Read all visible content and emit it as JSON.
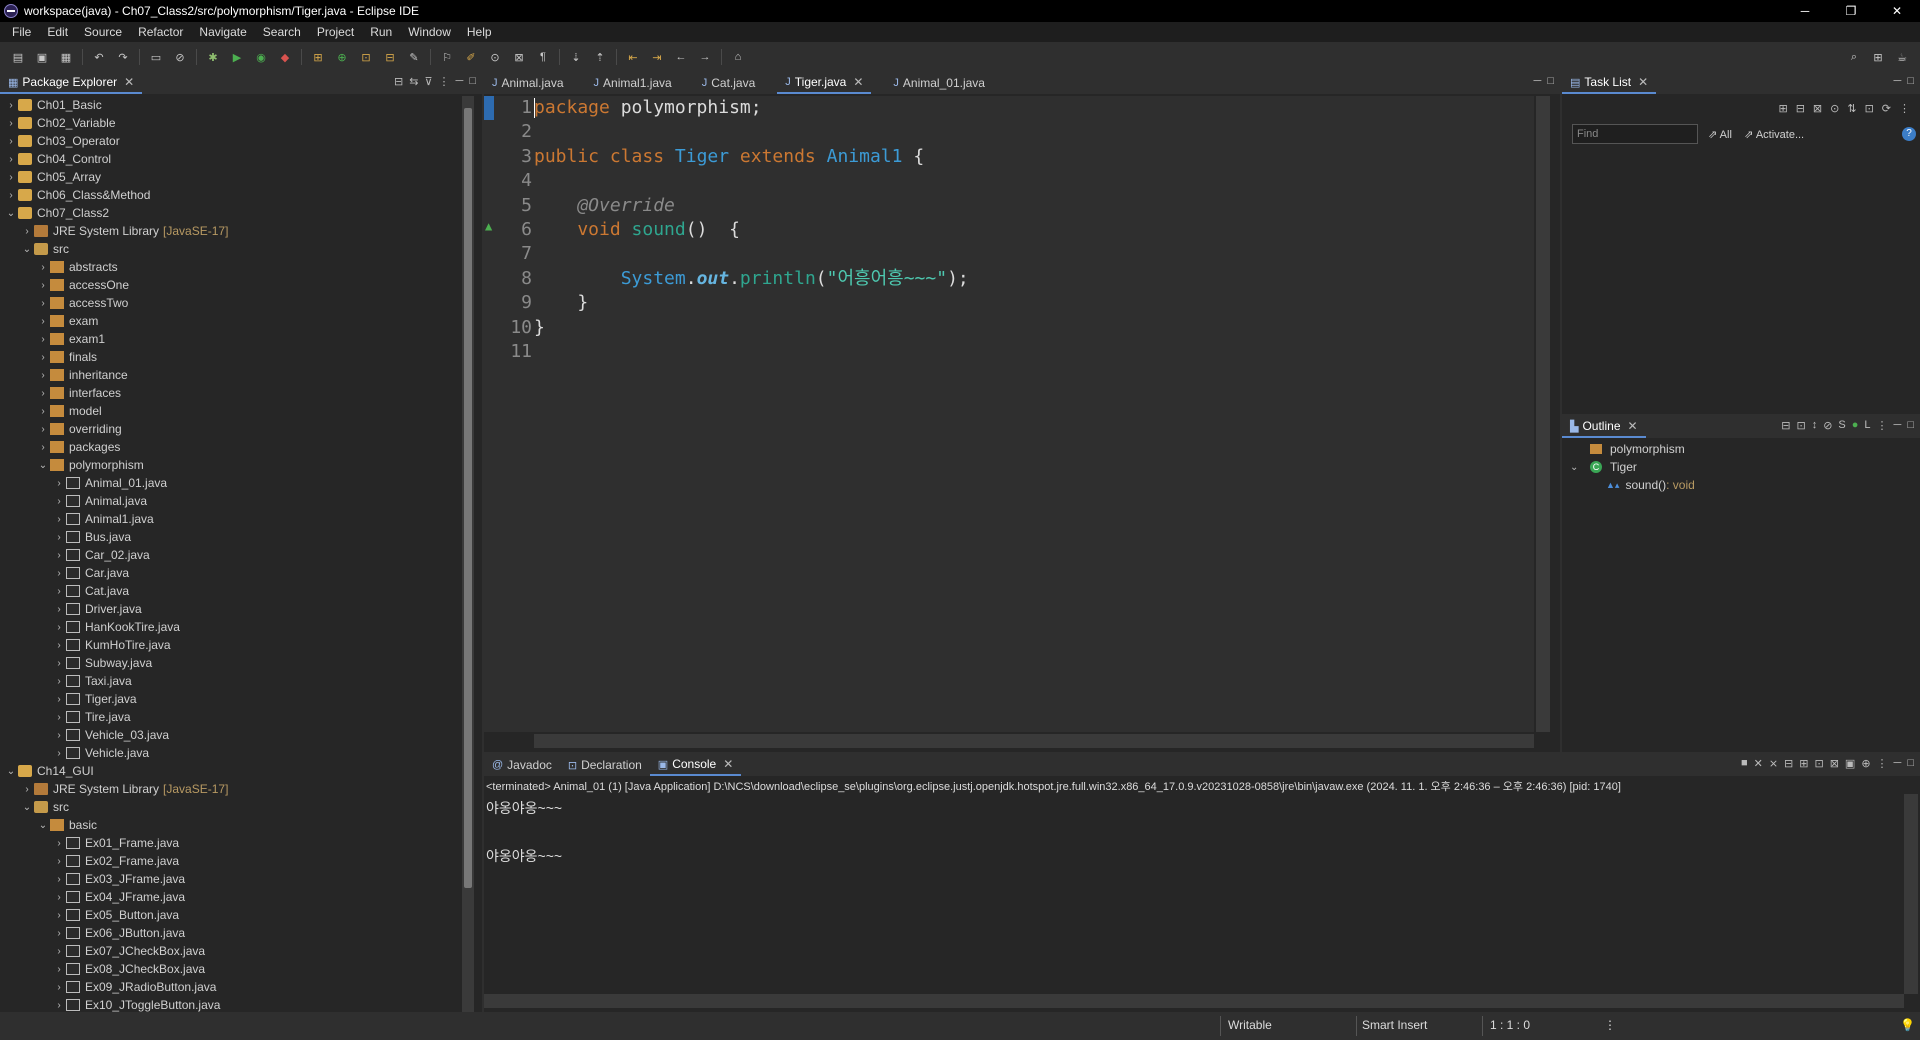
{
  "window": {
    "title": "workspace(java) - Ch07_Class2/src/polymorphism/Tiger.java - Eclipse IDE",
    "controls": [
      "─",
      "❐",
      "✕"
    ]
  },
  "menu": [
    "File",
    "Edit",
    "Source",
    "Refactor",
    "Navigate",
    "Search",
    "Project",
    "Run",
    "Window",
    "Help"
  ],
  "package_explorer": {
    "title": "Package Explorer",
    "items": [
      {
        "label": "Ch01_Basic",
        "level": 0,
        "open": false,
        "type": "project"
      },
      {
        "label": "Ch02_Variable",
        "level": 0,
        "open": false,
        "type": "project"
      },
      {
        "label": "Ch03_Operator",
        "level": 0,
        "open": false,
        "type": "project"
      },
      {
        "label": "Ch04_Control",
        "level": 0,
        "open": false,
        "type": "project"
      },
      {
        "label": "Ch05_Array",
        "level": 0,
        "open": false,
        "type": "project"
      },
      {
        "label": "Ch06_Class&Method",
        "level": 0,
        "open": false,
        "type": "project"
      },
      {
        "label": "Ch07_Class2",
        "level": 0,
        "open": true,
        "type": "project"
      },
      {
        "label": "JRE System Library",
        "suffix": "[JavaSE-17]",
        "level": 1,
        "open": false,
        "type": "lib"
      },
      {
        "label": "src",
        "level": 1,
        "open": true,
        "type": "src"
      },
      {
        "label": "abstracts",
        "level": 2,
        "open": false,
        "type": "pkg"
      },
      {
        "label": "accessOne",
        "level": 2,
        "open": false,
        "type": "pkg"
      },
      {
        "label": "accessTwo",
        "level": 2,
        "open": false,
        "type": "pkg"
      },
      {
        "label": "exam",
        "level": 2,
        "open": false,
        "type": "pkg"
      },
      {
        "label": "exam1",
        "level": 2,
        "open": false,
        "type": "pkg"
      },
      {
        "label": "finals",
        "level": 2,
        "open": false,
        "type": "pkg"
      },
      {
        "label": "inheritance",
        "level": 2,
        "open": false,
        "type": "pkg"
      },
      {
        "label": "interfaces",
        "level": 2,
        "open": false,
        "type": "pkg"
      },
      {
        "label": "model",
        "level": 2,
        "open": false,
        "type": "pkg"
      },
      {
        "label": "overriding",
        "level": 2,
        "open": false,
        "type": "pkg"
      },
      {
        "label": "packages",
        "level": 2,
        "open": false,
        "type": "pkg"
      },
      {
        "label": "polymorphism",
        "level": 2,
        "open": true,
        "type": "pkg"
      },
      {
        "label": "Animal_01.java",
        "level": 3,
        "open": false,
        "type": "java"
      },
      {
        "label": "Animal.java",
        "level": 3,
        "open": false,
        "type": "java"
      },
      {
        "label": "Animal1.java",
        "level": 3,
        "open": false,
        "type": "java"
      },
      {
        "label": "Bus.java",
        "level": 3,
        "open": false,
        "type": "java"
      },
      {
        "label": "Car_02.java",
        "level": 3,
        "open": false,
        "type": "java"
      },
      {
        "label": "Car.java",
        "level": 3,
        "open": false,
        "type": "java"
      },
      {
        "label": "Cat.java",
        "level": 3,
        "open": false,
        "type": "java"
      },
      {
        "label": "Driver.java",
        "level": 3,
        "open": false,
        "type": "java"
      },
      {
        "label": "HanKookTire.java",
        "level": 3,
        "open": false,
        "type": "java"
      },
      {
        "label": "KumHoTire.java",
        "level": 3,
        "open": false,
        "type": "java"
      },
      {
        "label": "Subway.java",
        "level": 3,
        "open": false,
        "type": "java"
      },
      {
        "label": "Taxi.java",
        "level": 3,
        "open": false,
        "type": "java"
      },
      {
        "label": "Tiger.java",
        "level": 3,
        "open": false,
        "type": "java"
      },
      {
        "label": "Tire.java",
        "level": 3,
        "open": false,
        "type": "java"
      },
      {
        "label": "Vehicle_03.java",
        "level": 3,
        "open": false,
        "type": "java"
      },
      {
        "label": "Vehicle.java",
        "level": 3,
        "open": false,
        "type": "java"
      },
      {
        "label": "Ch14_GUI",
        "level": 0,
        "open": true,
        "type": "project"
      },
      {
        "label": "JRE System Library",
        "suffix": "[JavaSE-17]",
        "level": 1,
        "open": false,
        "type": "lib"
      },
      {
        "label": "src",
        "level": 1,
        "open": true,
        "type": "src"
      },
      {
        "label": "basic",
        "level": 2,
        "open": true,
        "type": "pkg"
      },
      {
        "label": "Ex01_Frame.java",
        "level": 3,
        "open": false,
        "type": "java"
      },
      {
        "label": "Ex02_Frame.java",
        "level": 3,
        "open": false,
        "type": "java"
      },
      {
        "label": "Ex03_JFrame.java",
        "level": 3,
        "open": false,
        "type": "java"
      },
      {
        "label": "Ex04_JFrame.java",
        "level": 3,
        "open": false,
        "type": "java"
      },
      {
        "label": "Ex05_Button.java",
        "level": 3,
        "open": false,
        "type": "java"
      },
      {
        "label": "Ex06_JButton.java",
        "level": 3,
        "open": false,
        "type": "java"
      },
      {
        "label": "Ex07_JCheckBox.java",
        "level": 3,
        "open": false,
        "type": "java"
      },
      {
        "label": "Ex08_JCheckBox.java",
        "level": 3,
        "open": false,
        "type": "java"
      },
      {
        "label": "Ex09_JRadioButton.java",
        "level": 3,
        "open": false,
        "type": "java"
      },
      {
        "label": "Ex10_JToggleButton.java",
        "level": 3,
        "open": false,
        "type": "java"
      }
    ]
  },
  "editor": {
    "tabs": [
      {
        "label": "Animal.java",
        "active": false
      },
      {
        "label": "Animal1.java",
        "active": false
      },
      {
        "label": "Cat.java",
        "active": false
      },
      {
        "label": "Tiger.java",
        "active": true
      },
      {
        "label": "Animal_01.java",
        "active": false
      }
    ],
    "lines": [
      {
        "n": "1",
        "parts": [
          {
            "t": "package",
            "c": "kw"
          },
          {
            "t": " polymorphism;",
            "c": "plain"
          }
        ]
      },
      {
        "n": "2",
        "parts": []
      },
      {
        "n": "3",
        "parts": [
          {
            "t": "public class ",
            "c": "kw"
          },
          {
            "t": "Tiger",
            "c": "cls"
          },
          {
            "t": " extends ",
            "c": "kw"
          },
          {
            "t": "Animal1",
            "c": "cls"
          },
          {
            "t": " {",
            "c": "plain"
          }
        ]
      },
      {
        "n": "4",
        "parts": []
      },
      {
        "n": "5",
        "parts": [
          {
            "t": "    @Override",
            "c": "ann"
          }
        ]
      },
      {
        "n": "6",
        "parts": [
          {
            "t": "    void ",
            "c": "kw"
          },
          {
            "t": "sound",
            "c": "mth"
          },
          {
            "t": "()  {",
            "c": "plain"
          }
        ]
      },
      {
        "n": "7",
        "parts": []
      },
      {
        "n": "8",
        "parts": [
          {
            "t": "        System",
            "c": "cls"
          },
          {
            "t": ".",
            "c": "plain"
          },
          {
            "t": "out",
            "c": "fld"
          },
          {
            "t": ".",
            "c": "plain"
          },
          {
            "t": "println",
            "c": "mth"
          },
          {
            "t": "(",
            "c": "plain"
          },
          {
            "t": "\"어흥어흥~~~\"",
            "c": "str"
          },
          {
            "t": ");",
            "c": "plain"
          }
        ]
      },
      {
        "n": "9",
        "parts": [
          {
            "t": "    }",
            "c": "plain"
          }
        ]
      },
      {
        "n": "10",
        "parts": [
          {
            "t": "}",
            "c": "plain"
          }
        ]
      },
      {
        "n": "11",
        "parts": []
      }
    ]
  },
  "tasklist": {
    "title": "Task List",
    "find_placeholder": "Find",
    "all_label": "All",
    "activate_label": "Activate..."
  },
  "outline": {
    "title": "Outline",
    "package": "polymorphism",
    "class": "Tiger",
    "method": "sound()",
    "method_type": " : void"
  },
  "console": {
    "tabs": [
      {
        "label": "Javadoc",
        "active": false
      },
      {
        "label": "Declaration",
        "active": false
      },
      {
        "label": "Console",
        "active": true
      }
    ],
    "meta": "<terminated> Animal_01 (1) [Java Application] D:\\NCS\\download\\eclipse_se\\plugins\\org.eclipse.justj.openjdk.hotspot.jre.full.win32.x86_64_17.0.9.v20231028-0858\\jre\\bin\\javaw.exe  (2024. 11. 1. 오후 2:46:36 – 오후 2:46:36) [pid: 1740]",
    "lines": [
      "야옹야옹~~~",
      "",
      "야옹야옹~~~"
    ]
  },
  "status": {
    "writable": "Writable",
    "insert_mode": "Smart Insert",
    "position": "1 : 1 : 0"
  }
}
